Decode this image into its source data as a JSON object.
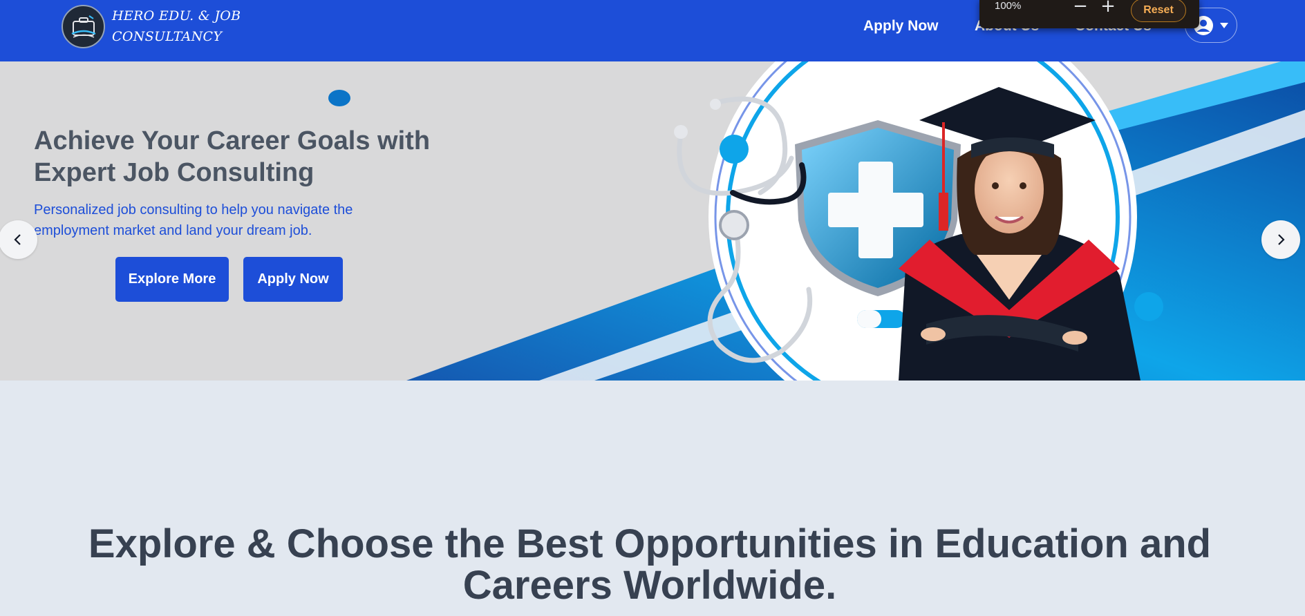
{
  "brand": {
    "line1": "HERO EDU. & JOB",
    "line2": "CONSULTANCY"
  },
  "nav": {
    "apply": "Apply Now",
    "about": "About Us",
    "contact": "Contact Us"
  },
  "user_menu": {
    "icon": "user-circle-icon",
    "caret": "caret-down-icon"
  },
  "zoom": {
    "level": "100%",
    "minus": "−",
    "plus": "+",
    "reset": "Reset"
  },
  "hero": {
    "title": "Achieve Your Career Goals with Expert Job Consulting",
    "subtitle": "Personalized job consulting to help you navigate the employment market and land your dream job.",
    "explore_label": "Explore More",
    "apply_label": "Apply Now",
    "prev_icon": "chevron-left-icon",
    "next_icon": "chevron-right-icon"
  },
  "section": {
    "title": "Explore & Choose the Best Opportunities in Education and Careers Worldwide."
  },
  "colors": {
    "primary": "#1d4ed8",
    "hero_bg": "#d9d9da",
    "page_bg": "#e2e8f0",
    "heading": "#374151",
    "accent_cyan": "#0ea5e9",
    "graduate_red": "#e11d2e"
  }
}
